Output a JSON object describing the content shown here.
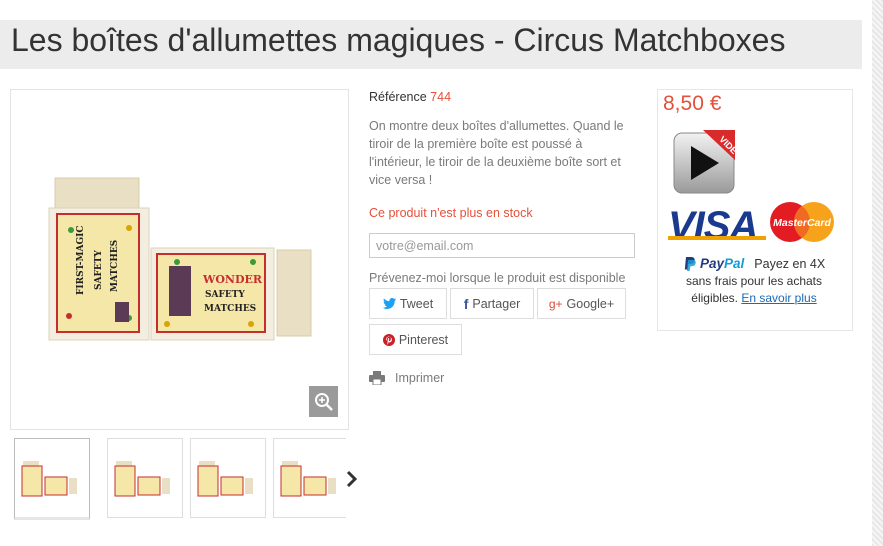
{
  "page": {
    "title": "Les boîtes d'allumettes magiques - Circus Matchboxes"
  },
  "product": {
    "reference_label": "Référence",
    "reference_value": "744",
    "description": "On montre deux boîtes d'allumettes. Quand le tiroir de la première boîte est poussé à l'intérieur, le tiroir de la deuxième boîte sort et vice versa !",
    "stock_status": "Ce produit n'est plus en stock",
    "email_placeholder": "votre@email.com",
    "notify_label": "Prévenez-moi lorsque le produit est disponible",
    "print_label": "Imprimer",
    "box_left_label": [
      "FIRST-MAGIC",
      "SAFETY",
      "MATCHES"
    ],
    "box_right_label": [
      "WONDER",
      "SAFETY",
      "MATCHES"
    ]
  },
  "share": {
    "tweet": "Tweet",
    "facebook": "Partager",
    "google": "Google+",
    "pinterest": "Pinterest",
    "facebook_icon_text": "f",
    "google_icon_text": "g+"
  },
  "gallery": {
    "thumbnail_count": 4
  },
  "buybox": {
    "price": "8,50 €",
    "video_badge": "VIDEO",
    "visa_text": "VISA",
    "mastercard_text": "MasterCard",
    "paypal_brand_a": "Pay",
    "paypal_brand_b": "Pal",
    "paypal_line1": "Payez en 4X",
    "paypal_line2": "sans frais pour les achats",
    "paypal_line3": "éligibles.",
    "paypal_link": "En savoir plus"
  },
  "colors": {
    "accent": "#e4513b",
    "link": "#1a6ab5",
    "visa_blue": "#1a3a8f"
  }
}
